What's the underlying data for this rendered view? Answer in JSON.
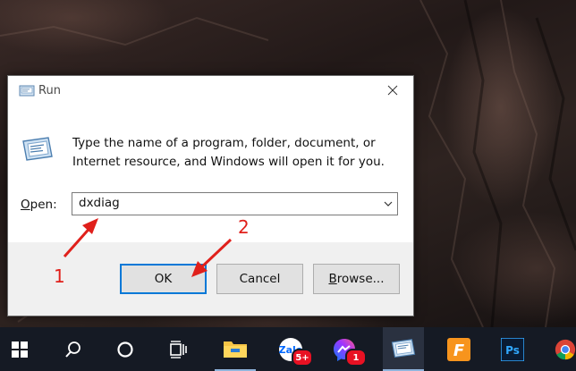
{
  "dialog": {
    "title": "Run",
    "description": "Type the name of a program, folder, document, or Internet resource, and Windows will open it for you.",
    "open_label_prefix": "",
    "open_label_mnemonic": "O",
    "open_label_rest": "pen:",
    "open_value": "dxdiag",
    "ok_label": "OK",
    "cancel_label": "Cancel",
    "browse_mnemonic": "B",
    "browse_rest": "rowse..."
  },
  "annotations": {
    "step1": "1",
    "step2": "2",
    "color": "#e0201b"
  },
  "taskbar": {
    "items": [
      {
        "name": "start-icon"
      },
      {
        "name": "search-icon"
      },
      {
        "name": "cortana-icon"
      },
      {
        "name": "task-view-icon"
      },
      {
        "name": "file-explorer-icon"
      },
      {
        "name": "zalo-icon",
        "badge": "5+"
      },
      {
        "name": "messenger-icon",
        "badge": "1"
      },
      {
        "name": "run-app-icon"
      },
      {
        "name": "filezilla-icon"
      },
      {
        "name": "photoshop-icon",
        "label": "Ps"
      },
      {
        "name": "chrome-icon"
      }
    ]
  }
}
